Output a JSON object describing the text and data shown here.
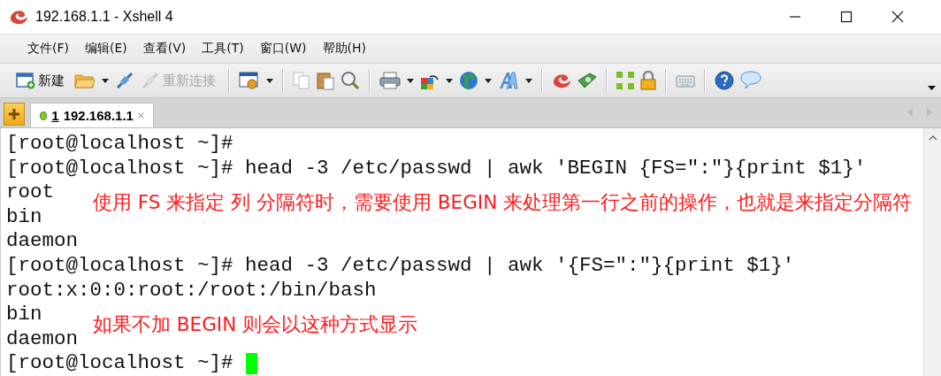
{
  "window": {
    "title": "192.168.1.1 - Xshell 4"
  },
  "menu": [
    {
      "label": "文件(F)"
    },
    {
      "label": "编辑(E)"
    },
    {
      "label": "查看(V)"
    },
    {
      "label": "工具(T)"
    },
    {
      "label": "窗口(W)"
    },
    {
      "label": "帮助(H)"
    }
  ],
  "toolbar": {
    "new": {
      "label": "新建"
    },
    "reconnect": {
      "label": "重新连接",
      "disabled": true
    }
  },
  "tabs": [
    {
      "number": "1",
      "label": "192.168.1.1",
      "selected": true,
      "connected": true
    }
  ],
  "terminal": {
    "lines": [
      {
        "text": "[root@localhost ~]#"
      },
      {
        "text": "[root@localhost ~]# head -3 /etc/passwd | awk 'BEGIN {FS=\":\"}{print $1}'"
      },
      {
        "text": "root",
        "note": "使用 FS 来指定 列 分隔符时，需要使用 BEGIN 来处理第一行之前的操作，也就是来指定分隔符"
      },
      {
        "text": "bin"
      },
      {
        "text": "daemon"
      },
      {
        "text": "[root@localhost ~]# head -3 /etc/passwd | awk '{FS=\":\"}{print $1}'"
      },
      {
        "text": "root:x:0:0:root:/root:/bin/bash"
      },
      {
        "text": "bin",
        "note": "如果不加 BEGIN 则会以这种方式显示"
      },
      {
        "text": "daemon"
      },
      {
        "text": "[root@localhost ~]#",
        "cursor": true
      }
    ]
  }
}
